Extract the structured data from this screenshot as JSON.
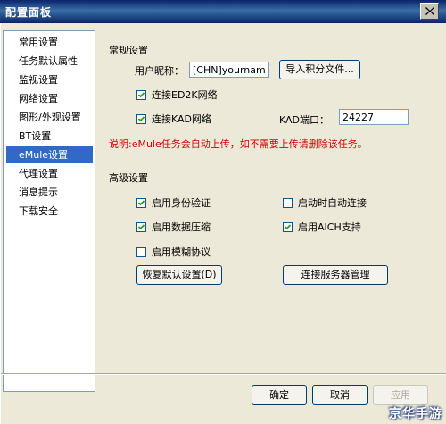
{
  "window": {
    "title": "配置面板",
    "close_glyph": "close-icon"
  },
  "sidebar": {
    "items": [
      {
        "label": "常用设置"
      },
      {
        "label": "任务默认属性"
      },
      {
        "label": "监视设置"
      },
      {
        "label": "网络设置"
      },
      {
        "label": "图形/外观设置"
      },
      {
        "label": "BT设置"
      },
      {
        "label": "eMule设置",
        "selected": true
      },
      {
        "label": "代理设置"
      },
      {
        "label": "消息提示"
      },
      {
        "label": "下载安全"
      }
    ]
  },
  "general": {
    "title": "常规设置",
    "nickname_label": "用户昵称：",
    "nickname_value": "[CHN]yourname",
    "import_button": "导入积分文件...",
    "ed2k_label": "连接ED2K网络",
    "ed2k_checked": true,
    "kad_label": "连接KAD网络",
    "kad_checked": true,
    "kad_port_label": "KAD端口：",
    "kad_port_value": "24227",
    "note": "说明:eMule任务会自动上传，如不需要上传请删除该任务。"
  },
  "advanced": {
    "title": "高级设置",
    "auth_label": "启用身份验证",
    "auth_checked": true,
    "autoconnect_label": "启动时自动连接",
    "autoconnect_checked": false,
    "compression_label": "启用数据压缩",
    "compression_checked": true,
    "aich_label": "启用AICH支持",
    "aich_checked": true,
    "obfuscation_label": "启用模糊协议",
    "obfuscation_checked": false,
    "restore_button_prefix": "恢复默认设置(",
    "restore_button_key": "D",
    "restore_button_suffix": ")",
    "server_manage_button": "连接服务器管理"
  },
  "footer": {
    "ok": "确定",
    "cancel": "取消",
    "apply": "应用"
  },
  "watermark": "京华手游",
  "colors": {
    "selection": "#316ac5",
    "note_red": "#d40000",
    "title_bar": "#0a246a"
  }
}
